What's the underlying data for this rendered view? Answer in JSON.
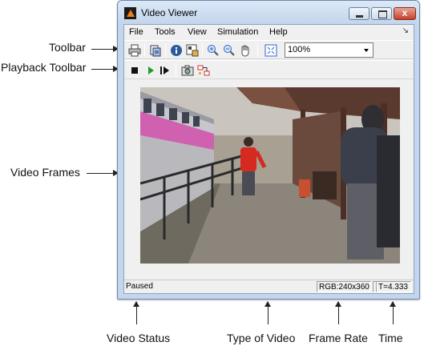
{
  "annotations": {
    "toolbar": "Toolbar",
    "playback_toolbar": "Playback Toolbar",
    "video_frames": "Video Frames",
    "video_status": "Video Status",
    "type_of_video": "Type of Video",
    "frame_rate": "Frame Rate",
    "time": "Time"
  },
  "window": {
    "title": "Video Viewer",
    "close_glyph": "x"
  },
  "menu": {
    "items": [
      "File",
      "Tools",
      "View",
      "Simulation",
      "Help"
    ],
    "dock_glyph": "↘"
  },
  "toolbar": {
    "buttons": [
      "print-icon",
      "new-window-icon",
      "info-icon",
      "pixel-region-icon",
      "zoom-in-icon",
      "zoom-out-icon",
      "pan-icon",
      "fit-to-window-icon"
    ],
    "zoom_value": "100%"
  },
  "playback": {
    "buttons": [
      "stop-icon",
      "play-icon",
      "step-forward-icon",
      "snapshot-icon",
      "highlight-simulink-icon"
    ]
  },
  "status": {
    "state": "Paused",
    "video_type": "RGB:240x360",
    "time": "T=4.333"
  },
  "colors": {
    "title_gradient_top": "#dbe8f7",
    "title_gradient_bottom": "#c2d5ec",
    "close_button": "#c4402a",
    "train_stripe": "#d060b0",
    "shirt": "#d42a20"
  }
}
